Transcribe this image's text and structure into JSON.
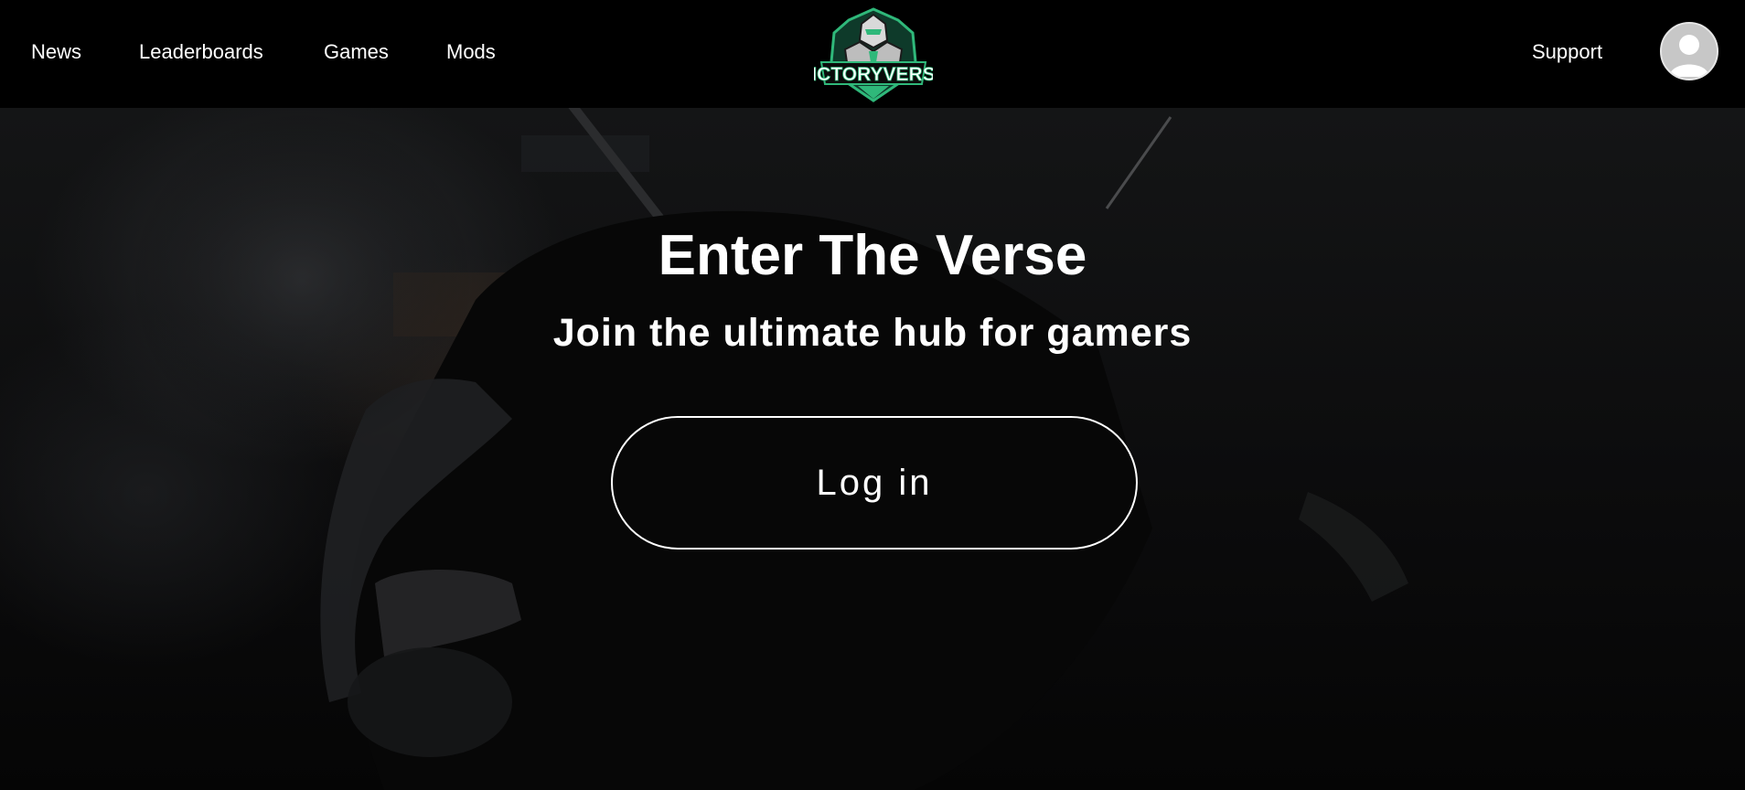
{
  "header": {
    "nav": [
      {
        "label": "News"
      },
      {
        "label": "Leaderboards"
      },
      {
        "label": "Games"
      },
      {
        "label": "Mods"
      }
    ],
    "logo_text": "VICTORYVERSE",
    "support_label": "Support",
    "avatar_icon": "user-avatar-icon"
  },
  "hero": {
    "title": "Enter The Verse",
    "subtitle": "Join the ultimate hub for gamers",
    "login_label": "Log in"
  },
  "colors": {
    "background": "#000000",
    "text": "#ffffff",
    "logo_accent": "#2fb87a",
    "avatar_bg": "#c7c7c7"
  }
}
